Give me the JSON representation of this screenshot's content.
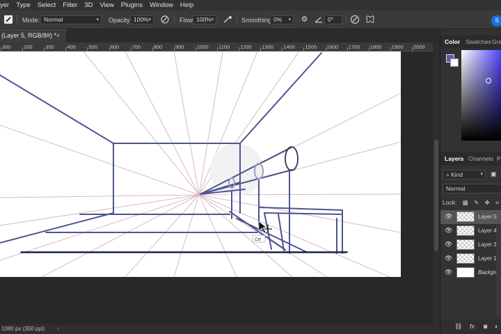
{
  "menu": [
    "yer",
    "Type",
    "Select",
    "Filter",
    "3D",
    "View",
    "Plugins",
    "Window",
    "Help"
  ],
  "options": {
    "mode_label": "Mode:",
    "mode_value": "Normal",
    "opacity_label": "Opacity:",
    "opacity_value": "100%",
    "flow_label": "Flow:",
    "flow_value": "100%",
    "smoothing_label": "Smoothing:",
    "smoothing_value": "0%",
    "angle_value": "0°"
  },
  "document_tab": {
    "title": "(Layer 5, RGB/8#) *",
    "close": "×"
  },
  "ruler_ticks": [
    "300",
    "200",
    "300",
    "400",
    "500",
    "600",
    "700",
    "800",
    "900",
    "1000",
    "1100",
    "1200",
    "1300",
    "1400",
    "1500",
    "1600",
    "1700",
    "1800",
    "1900",
    "2000"
  ],
  "tooltip": "Ctrl",
  "status": {
    "text": "1080 px (300 ppi)",
    "caret": "›"
  },
  "panels": {
    "color_tabs": [
      "Color",
      "Swatches",
      "Gra"
    ],
    "layers_tabs": [
      "Layers",
      "Channels",
      "P"
    ],
    "kind_label": "Kind",
    "blend_mode": "Normal",
    "lock_label": "Lock:",
    "layers": [
      {
        "name": "Layer 5",
        "selected": true,
        "background": false
      },
      {
        "name": "Layer 4",
        "selected": false,
        "background": false
      },
      {
        "name": "Layer 3",
        "selected": false,
        "background": false
      },
      {
        "name": "Layer 1",
        "selected": false,
        "background": false
      },
      {
        "name": "Background",
        "selected": false,
        "background": true
      }
    ],
    "foreground_color": "#5a5fa8",
    "background_color": "#ffffff"
  },
  "colors": {
    "sketch_blue": "#4b5590",
    "guide_pink": "#d9b3bd",
    "accent": "#1473e6"
  },
  "icons": [
    "brush-icon",
    "settings-icon",
    "angle-icon",
    "butterfly-icon",
    "search-icon",
    "eye-icon",
    "lock-icon",
    "fx-icon",
    "link-icon"
  ]
}
